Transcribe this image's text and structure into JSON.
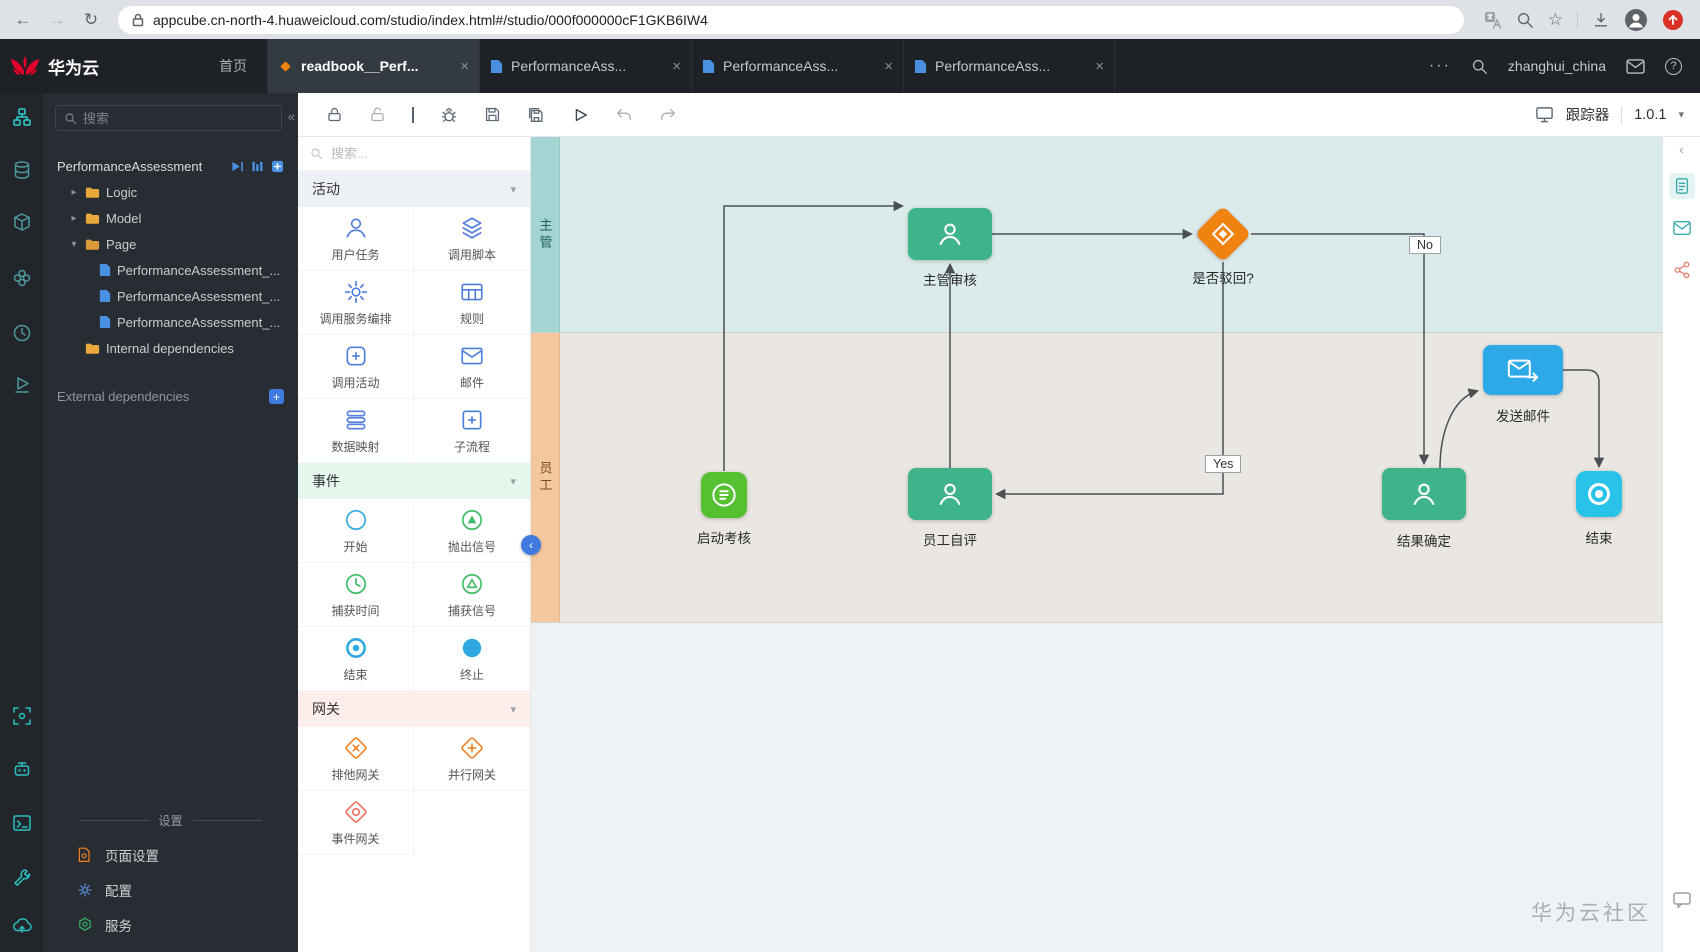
{
  "browser": {
    "url": "appcube.cn-north-4.huaweicloud.com/studio/index.html#/studio/000f000000cF1GKB6IW4"
  },
  "glyphs": {
    "back": "←",
    "forward": "→",
    "refresh": "↻",
    "star": "☆",
    "more": "···",
    "help": "?",
    "close": "×",
    "caret_closed": "▸",
    "caret_open": "▾",
    "collapse_left": "«",
    "chevron_left": "‹",
    "chevron_down": "▾",
    "plus": "+"
  },
  "header": {
    "brand": "华为云",
    "home": "首页",
    "username": "zhanghui_china",
    "tabs": [
      {
        "label": "readbook__Perf..."
      },
      {
        "label": "PerformanceAss..."
      },
      {
        "label": "PerformanceAss..."
      },
      {
        "label": "PerformanceAss..."
      }
    ]
  },
  "toolbar": {
    "tracker": "跟踪器",
    "version": "1.0.1"
  },
  "explorer": {
    "search_placeholder": "搜索",
    "project": "PerformanceAssessment",
    "folders": [
      "Logic",
      "Model",
      "Page"
    ],
    "pages": [
      "PerformanceAssessment_...",
      "PerformanceAssessment_...",
      "PerformanceAssessment_..."
    ],
    "internal": "Internal dependencies",
    "external": "External dependencies",
    "settings_title": "设置",
    "settings": [
      "页面设置",
      "配置",
      "服务"
    ]
  },
  "palette": {
    "search_placeholder": "搜索...",
    "sections": [
      {
        "title": "活动",
        "items": [
          "用户任务",
          "调用脚本",
          "调用服务编排",
          "规则",
          "调用活动",
          "邮件",
          "数据映射",
          "子流程"
        ]
      },
      {
        "title": "事件",
        "items": [
          "开始",
          "抛出信号",
          "捕获时间",
          "捕获信号",
          "结束",
          "终止"
        ]
      },
      {
        "title": "网关",
        "items": [
          "排他网关",
          "并行网关",
          "事件网关"
        ]
      }
    ]
  },
  "canvas": {
    "lanes": [
      "主管",
      "员工"
    ],
    "nodes": {
      "start": "启动考核",
      "supervisor_review": "主管审核",
      "reject_gateway": "是否驳回?",
      "self_eval": "员工自评",
      "send_mail": "发送邮件",
      "result_confirm": "结果确定",
      "end": "结束"
    },
    "edge_labels": {
      "no": "No",
      "yes": "Yes"
    },
    "watermark": "华为云社区"
  },
  "colors": {
    "huawei_red": "#e4002b",
    "accent_teal": "#2bb3b3",
    "task_green": "#3fb389",
    "start_green": "#55c131",
    "gateway_orange": "#f0830f",
    "mail_blue": "#2da9e8",
    "end_cyan": "#29c3ea",
    "palette_blue": "#4f7dd9",
    "event_green": "#3dba62",
    "lane_supervisor_band": "#a5d5d3",
    "lane_employee_band": "#f4c89f"
  }
}
